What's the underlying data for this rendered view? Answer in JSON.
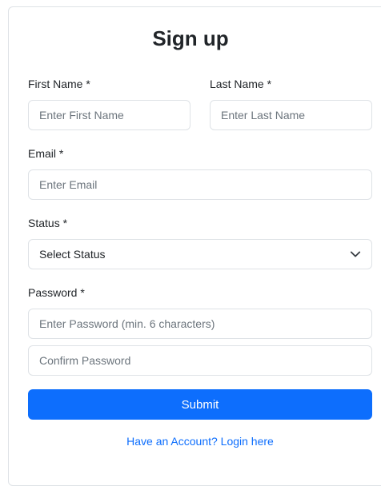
{
  "form": {
    "title": "Sign up",
    "first_name": {
      "label": "First Name *",
      "placeholder": "Enter First Name"
    },
    "last_name": {
      "label": "Last Name *",
      "placeholder": "Enter Last Name"
    },
    "email": {
      "label": "Email *",
      "placeholder": "Enter Email"
    },
    "status": {
      "label": "Status *",
      "selected": "Select Status",
      "icon": "chevron-down-icon"
    },
    "password": {
      "label": "Password *",
      "placeholder": "Enter Password (min. 6 characters)",
      "confirm_placeholder": "Confirm Password"
    },
    "submit_label": "Submit",
    "login_link": "Have an Account? Login here"
  },
  "colors": {
    "primary": "#0d6efd",
    "border": "#dee2e6",
    "placeholder": "#6c757d",
    "text": "#212529"
  }
}
